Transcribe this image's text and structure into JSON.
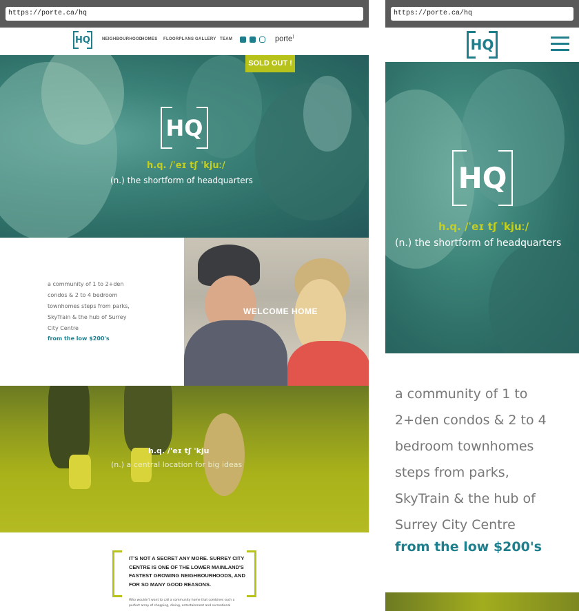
{
  "desktop": {
    "url": "https://porte.ca/hq",
    "logo_text": "HQ",
    "nav": {
      "items": [
        "NEIGHBOURHOOD",
        "HOMES",
        "FLOORPLANS",
        "GALLERY",
        "TEAM"
      ],
      "brand": "porte"
    },
    "hero": {
      "badge": "SOLD OUT !",
      "logo_text": "HQ",
      "pronunciation": "h.q. /ˈeɪ tʃ ˈkjuː/",
      "definition": "(n.)  the shortform of headquarters"
    },
    "intro": {
      "text": "a community of 1 to 2+den condos & 2 to 4 bedroom townhomes steps from parks, SkyTrain & the hub of Surrey City Centre",
      "price": "from the low $200's",
      "photo_label": "WELCOME HOME"
    },
    "dog_section": {
      "pronunciation": "h.q. /ˈeɪ tʃ ˈkju",
      "definition": "(n.)  a central location for big ideas"
    },
    "quote": {
      "headline": "It's not a secret any more. Surrey City Centre is one of the lower mainland's fastest growing neighbourhoods, and for so many good reasons.",
      "body": "Who wouldn't want to call a community home that combines such a perfect array of shopping, dining, entertainment and recreational"
    }
  },
  "mobile": {
    "url": "https://porte.ca/hq",
    "logo_text": "HQ",
    "hero": {
      "logo_text": "HQ",
      "pronunciation": "h.q. /ˈeɪ tʃ ˈkjuː/",
      "definition": "(n.)  the shortform of headquarters"
    },
    "intro": {
      "text": "a community of 1 to 2+den condos & 2 to 4 bedroom townhomes steps from parks, SkyTrain & the hub of Surrey City Centre",
      "price": "from the low $200's"
    }
  },
  "colors": {
    "teal": "#1f7e8c",
    "lime": "#b7c31a",
    "hero_overlay": "#3b8279",
    "chrome": "#5a5a5a"
  },
  "icons": [
    "twitter-icon",
    "facebook-icon",
    "instagram-icon",
    "hamburger-menu-icon"
  ]
}
